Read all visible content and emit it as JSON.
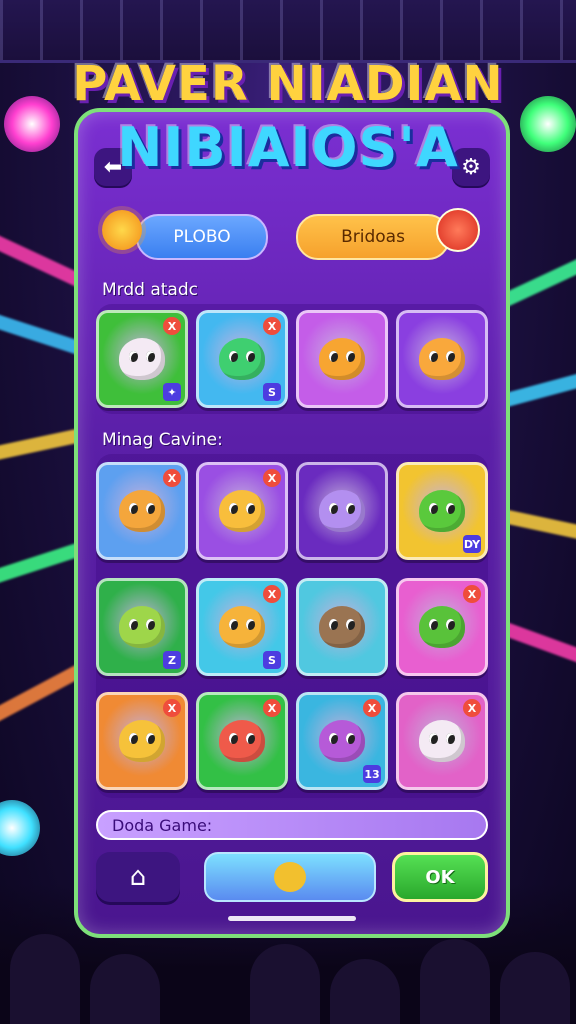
{
  "title": {
    "line1": "PAVER NIADIAN",
    "line2": "NIBIAIOS'A"
  },
  "header": {
    "back_icon": "back-arrow-icon",
    "settings_icon": "gear-icon",
    "left_pill": "PLOBO",
    "right_pill": "Bridoas"
  },
  "sections": {
    "first_label": "Mrdd atadc",
    "second_label": "Minag Cavine:",
    "footer_label": "Doda Game:"
  },
  "grid_row1": [
    {
      "color": "#3fbf3a",
      "creature": "#f4eaf4",
      "badge_tr": "X",
      "badge_br": "✦"
    },
    {
      "color": "#43b8f0",
      "creature": "#3fcf70",
      "badge_tr": "X",
      "badge_br": "S"
    },
    {
      "color": "#c45de8",
      "creature": "#f7a531",
      "badge_tr": "",
      "badge_br": ""
    },
    {
      "color": "#8a3fe0",
      "creature": "#f9a83c",
      "badge_tr": "",
      "badge_br": ""
    }
  ],
  "grid_row2": [
    {
      "color": "#5da0f0",
      "creature": "#f4a63c",
      "badge_tr": "X",
      "badge_br": ""
    },
    {
      "color": "#9a4fe3",
      "creature": "#f8be3c",
      "badge_tr": "X",
      "badge_br": ""
    },
    {
      "color": "#6a2bbf",
      "creature": "#b38ff0",
      "badge_tr": "",
      "badge_br": ""
    },
    {
      "color": "#f2c430",
      "creature": "#5ac93c",
      "badge_tr": "",
      "badge_br": "DY"
    }
  ],
  "grid_row3": [
    {
      "color": "#2fb04a",
      "creature": "#9ed64a",
      "badge_tr": "",
      "badge_br": "Z"
    },
    {
      "color": "#43c8e8",
      "creature": "#f6b33a",
      "badge_tr": "X",
      "badge_br": "S"
    },
    {
      "color": "#50c8e0",
      "creature": "#9a7452",
      "badge_tr": "",
      "badge_br": ""
    },
    {
      "color": "#e85fd0",
      "creature": "#59c23a",
      "badge_tr": "X",
      "badge_br": ""
    }
  ],
  "grid_row4": [
    {
      "color": "#f08a34",
      "creature": "#f6c23a",
      "badge_tr": "X",
      "badge_br": ""
    },
    {
      "color": "#33c046",
      "creature": "#ef5a4a",
      "badge_tr": "X",
      "badge_br": ""
    },
    {
      "color": "#3ab6e0",
      "creature": "#b65ad8",
      "badge_tr": "X",
      "badge_br": "13"
    },
    {
      "color": "#e262c8",
      "creature": "#f4eaf4",
      "badge_tr": "X",
      "badge_br": ""
    }
  ],
  "buttons": {
    "home_icon": "home-icon",
    "ok": "OK"
  },
  "colors": {
    "panel_border": "#7ee07a",
    "ok_button": "#35c23a",
    "left_pill": "#3a7ff0",
    "right_pill": "#f6a12c"
  }
}
